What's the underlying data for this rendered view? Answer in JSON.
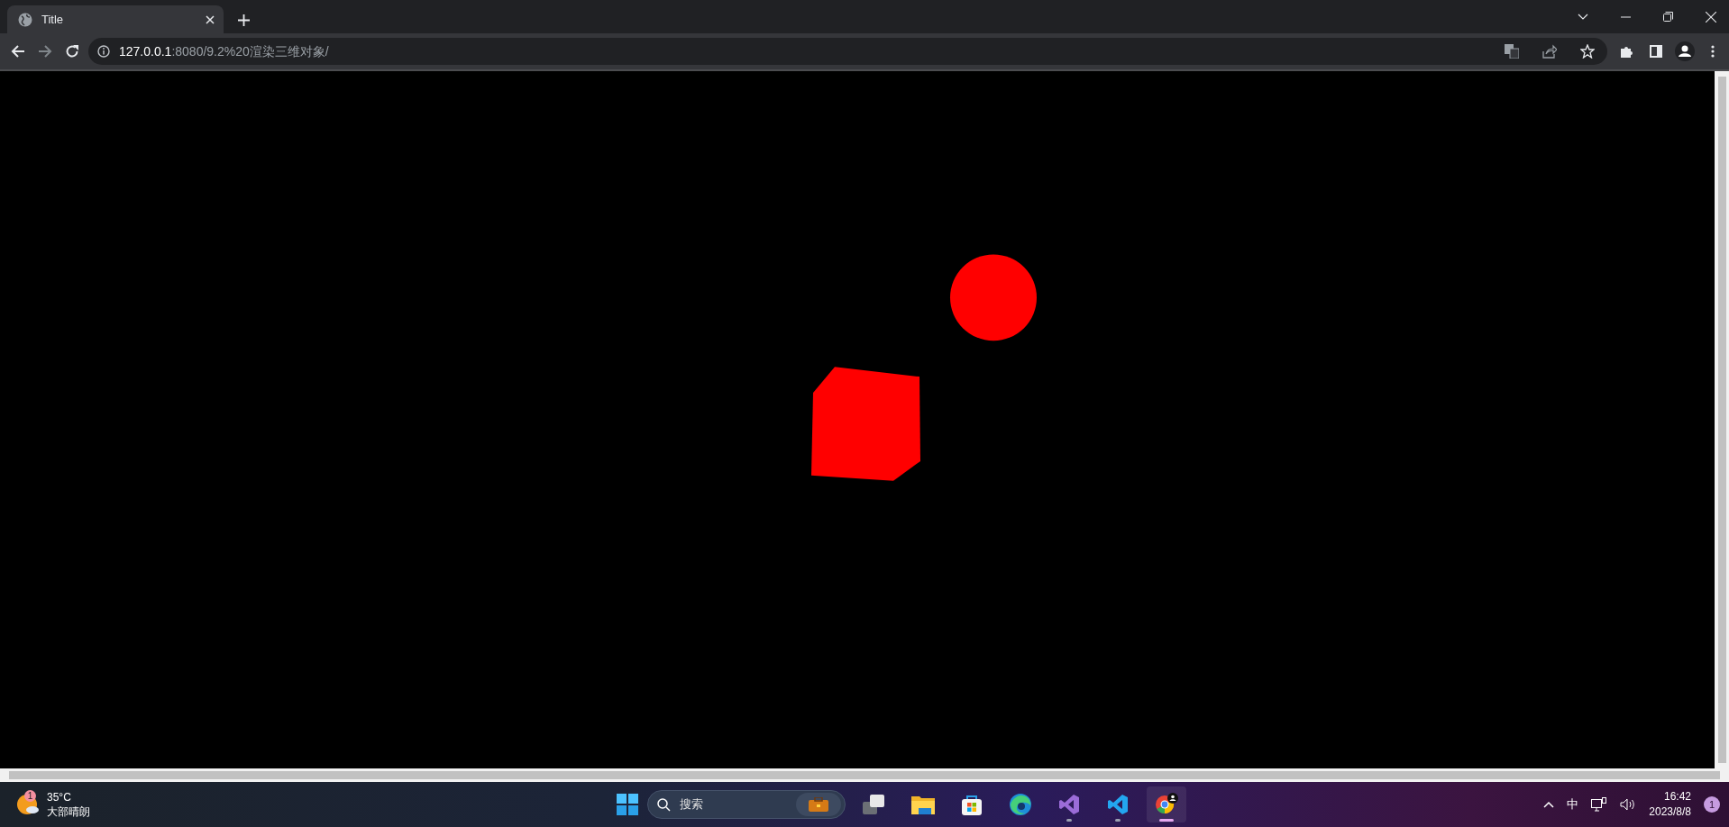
{
  "browser": {
    "tab": {
      "title": "Title",
      "selected": true
    },
    "address": {
      "host": "127.0.0.1",
      "path": ":8080/9.2%20渲染三维对象/"
    }
  },
  "taskbar": {
    "weather": {
      "badge": "1",
      "temperature": "35°C",
      "condition": "大部晴朗"
    },
    "search": {
      "placeholder": "搜索"
    },
    "apps": [
      {
        "kind": "taskview",
        "running": false,
        "selected": false
      },
      {
        "kind": "folder",
        "running": false,
        "selected": false
      },
      {
        "kind": "store",
        "running": false,
        "selected": false
      },
      {
        "kind": "edge",
        "running": false,
        "selected": false
      },
      {
        "kind": "visualstudio",
        "running": true,
        "selected": false
      },
      {
        "kind": "vscode",
        "running": true,
        "selected": false
      },
      {
        "kind": "chrome",
        "running": true,
        "selected": true
      }
    ],
    "tray": {
      "ime": "中",
      "time": "16:42",
      "date": "2023/8/8",
      "notification_count": "1"
    }
  }
}
